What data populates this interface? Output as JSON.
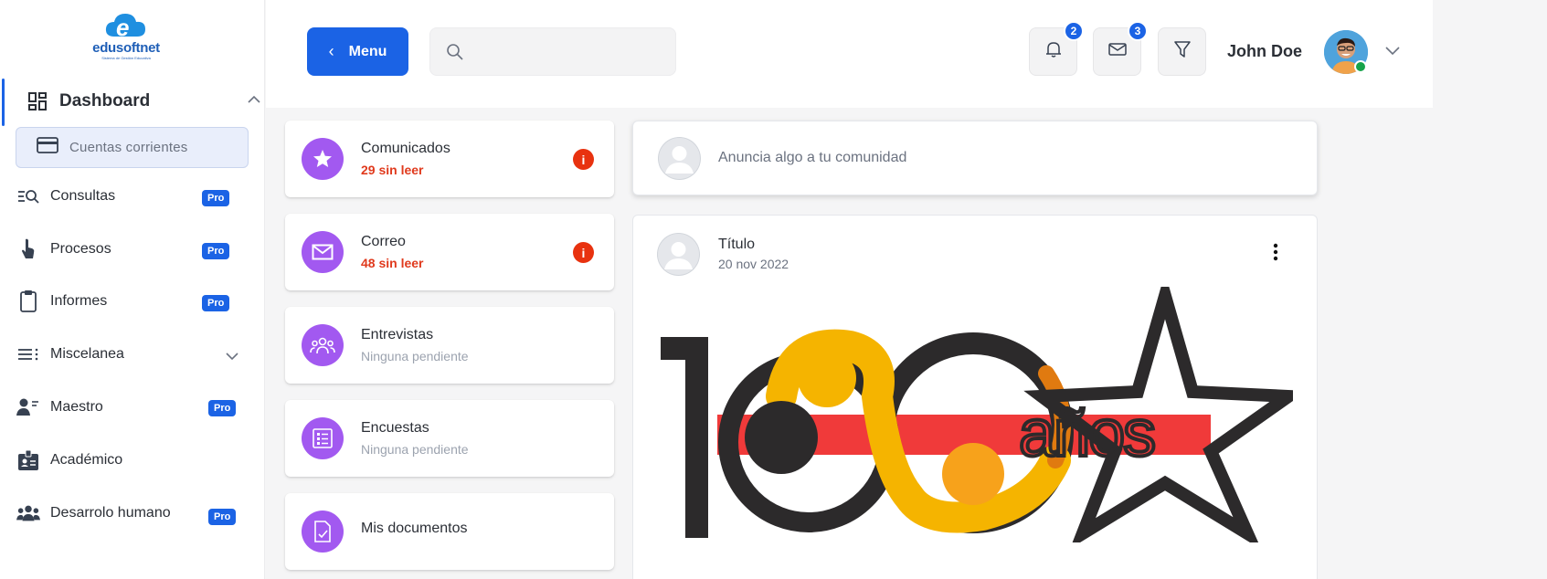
{
  "brand": {
    "name": "edusoftnet",
    "tagline": "Sistema de Gestión Educativa"
  },
  "sidebar": {
    "dashboard": {
      "label": "Dashboard",
      "icon": "dashboard-icon"
    },
    "active_sub": {
      "label": "Cuentas corrientes",
      "icon": "credit-card-icon"
    },
    "items": [
      {
        "label": "Consultas",
        "icon": "search-list-icon",
        "badge": "Pro"
      },
      {
        "label": "Procesos",
        "icon": "touch-icon",
        "badge": "Pro"
      },
      {
        "label": "Informes",
        "icon": "clipboard-icon",
        "badge": "Pro"
      },
      {
        "label": "Miscelanea",
        "icon": "list-icon",
        "badge": ""
      },
      {
        "label": "Maestro",
        "icon": "teacher-icon",
        "badge": "Pro"
      },
      {
        "label": "Académico",
        "icon": "id-badge-icon",
        "badge": ""
      },
      {
        "label": "Desarrolo humano",
        "icon": "people-icon",
        "badge": "Pro"
      }
    ]
  },
  "header": {
    "menu_label": "Menu",
    "search_placeholder": "",
    "notifications_count": "2",
    "messages_count": "3",
    "user_name": "John Doe"
  },
  "cards": [
    {
      "title": "Comunicados",
      "subtitle": "29 sin leer",
      "alert": true,
      "icon": "star-icon"
    },
    {
      "title": "Correo",
      "subtitle": "48 sin leer",
      "alert": true,
      "icon": "mail-icon"
    },
    {
      "title": "Entrevistas",
      "subtitle": "Ninguna pendiente",
      "alert": false,
      "icon": "group-icon"
    },
    {
      "title": "Encuestas",
      "subtitle": "Ninguna pendiente",
      "alert": false,
      "icon": "survey-icon"
    },
    {
      "title": "Mis documentos",
      "subtitle": "",
      "alert": false,
      "icon": "document-icon"
    }
  ],
  "composer": {
    "prompt": "Anuncia algo a tu comunidad"
  },
  "post": {
    "title": "Título",
    "date": "20 nov 2022",
    "image_text": "100 años"
  },
  "colors": {
    "primary": "#1b63e5",
    "accent_purple": "#a259f0",
    "alert_red": "#e03a1d",
    "logo_red": "#f03a3a",
    "logo_yellow": "#f5b400",
    "logo_dark": "#2c2a2b"
  }
}
